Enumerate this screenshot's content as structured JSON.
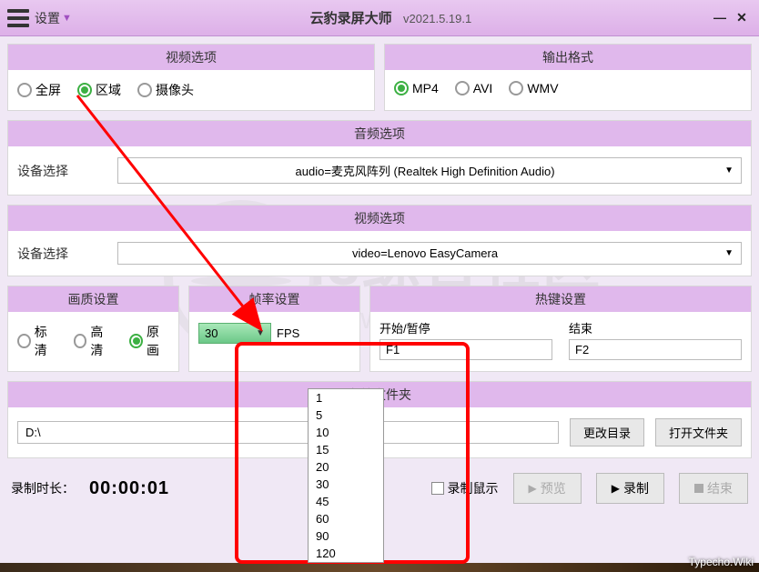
{
  "titlebar": {
    "settings": "设置",
    "app_name": "云豹录屏大师",
    "version": "v2021.5.19.1"
  },
  "panels": {
    "video_opts": {
      "title": "视频选项",
      "opt_full": "全屏",
      "opt_region": "区域",
      "opt_cam": "摄像头"
    },
    "output_fmt": {
      "title": "输出格式",
      "opt_mp4": "MP4",
      "opt_avi": "AVI",
      "opt_wmv": "WMV"
    },
    "audio": {
      "title": "音频选项",
      "label": "设备选择",
      "value": "audio=麦克风阵列 (Realtek High Definition Audio)"
    },
    "video_dev": {
      "title": "视频选项",
      "label": "设备选择",
      "value": "video=Lenovo EasyCamera"
    },
    "quality": {
      "title": "画质设置",
      "opt_sd": "标清",
      "opt_hd": "高清",
      "opt_orig": "原画"
    },
    "fps": {
      "title": "帧率设置",
      "value": "30",
      "unit": "FPS",
      "options": [
        "1",
        "5",
        "10",
        "15",
        "20",
        "30",
        "45",
        "60",
        "90",
        "120"
      ]
    },
    "hotkey": {
      "title": "热键设置",
      "start_label": "开始/暂停",
      "start_val": "F1",
      "stop_label": "结束",
      "stop_val": "F2"
    },
    "folder": {
      "title": "存储文件夹",
      "path": "D:\\",
      "change": "更改目录",
      "open": "打开文件夹"
    }
  },
  "bottom": {
    "rec_label": "录制时长：",
    "rec_time": "00:00:01",
    "mouse_check": "录制鼠示",
    "preview": "预览",
    "record": "录制",
    "stop": "结束"
  },
  "watermark": {
    "text": "i3综合社区",
    "url": "www.i3zh.com"
  },
  "credit": "Typecho.Wiki"
}
